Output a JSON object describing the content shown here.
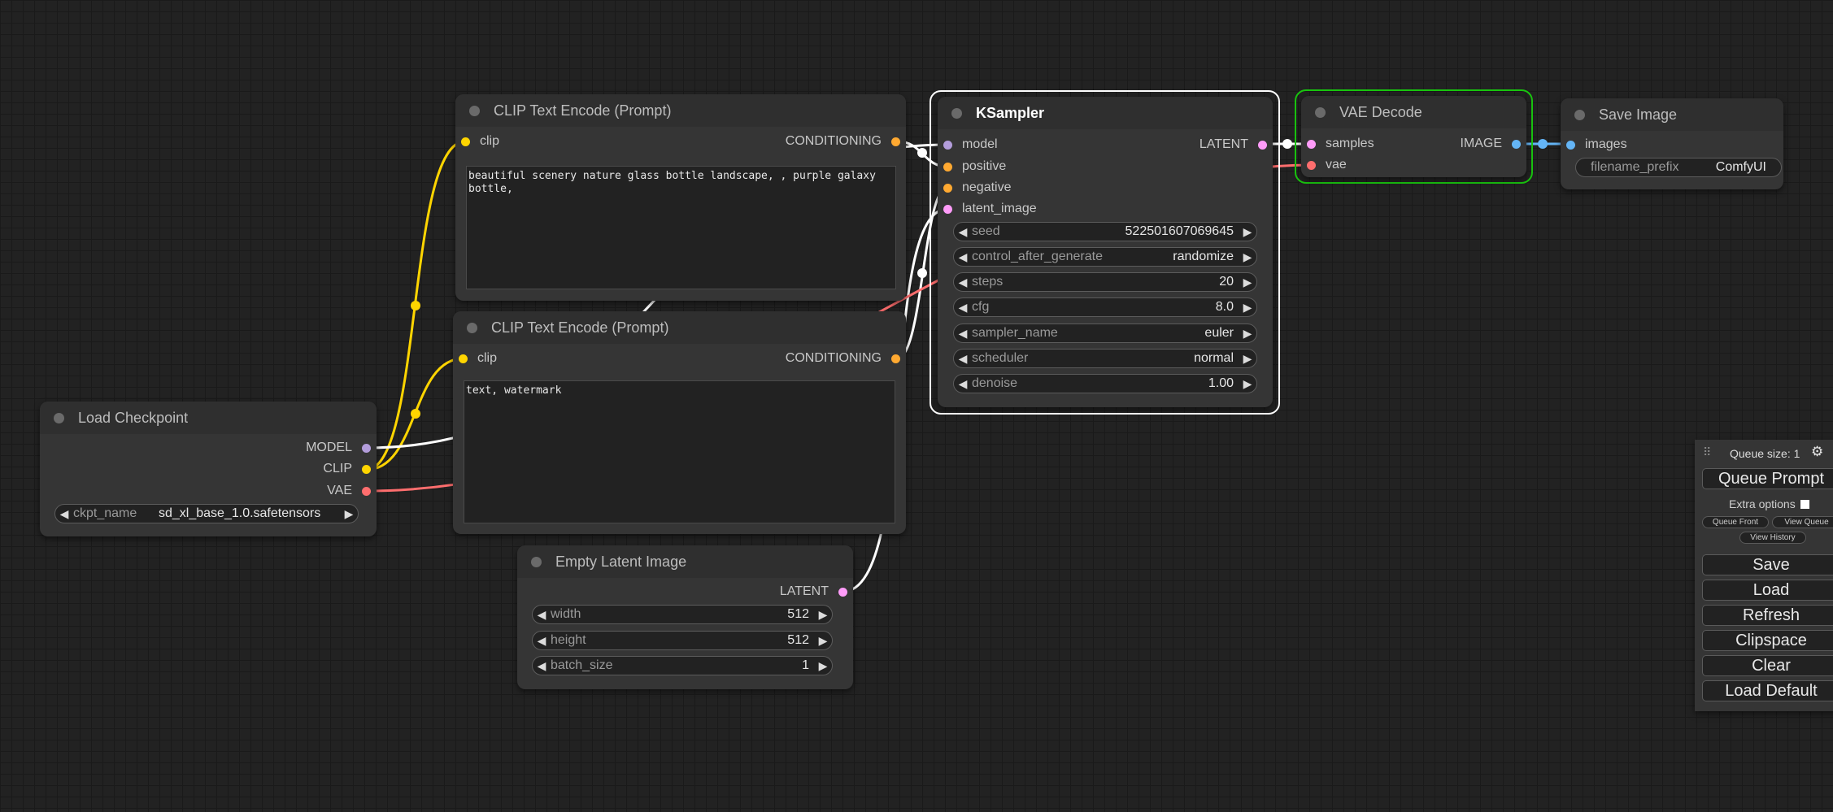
{
  "colors": {
    "model": "#b39ddb",
    "clip": "#ffd500",
    "vae": "#ff6e6e",
    "conditioning": "#ffa931",
    "latent": "#ff9cf9",
    "image": "#64b5f6",
    "link_white": "#ffffff",
    "selected": "#ffffff",
    "executing": "#19c50f"
  },
  "nodes": {
    "clip_pos": {
      "title": "CLIP Text Encode (Prompt)",
      "input_clip": "clip",
      "output": "CONDITIONING",
      "text": "beautiful scenery nature glass bottle landscape, , purple galaxy bottle,"
    },
    "clip_neg": {
      "title": "CLIP Text Encode (Prompt)",
      "input_clip": "clip",
      "output": "CONDITIONING",
      "text": "text, watermark"
    },
    "checkpoint": {
      "title": "Load Checkpoint",
      "outputs": [
        "MODEL",
        "CLIP",
        "VAE"
      ],
      "ckpt_label": "ckpt_name",
      "ckpt_value": "sd_xl_base_1.0.safetensors"
    },
    "latent": {
      "title": "Empty Latent Image",
      "output": "LATENT",
      "widgets": [
        {
          "label": "width",
          "value": "512"
        },
        {
          "label": "height",
          "value": "512"
        },
        {
          "label": "batch_size",
          "value": "1"
        }
      ]
    },
    "ksampler": {
      "title": "KSampler",
      "inputs": [
        "model",
        "positive",
        "negative",
        "latent_image"
      ],
      "output": "LATENT",
      "widgets": [
        {
          "label": "seed",
          "value": "522501607069645"
        },
        {
          "label": "control_after_generate",
          "value": "randomize"
        },
        {
          "label": "steps",
          "value": "20"
        },
        {
          "label": "cfg",
          "value": "8.0"
        },
        {
          "label": "sampler_name",
          "value": "euler"
        },
        {
          "label": "scheduler",
          "value": "normal"
        },
        {
          "label": "denoise",
          "value": "1.00"
        }
      ]
    },
    "vae_decode": {
      "title": "VAE Decode",
      "inputs": [
        "samples",
        "vae"
      ],
      "output": "IMAGE"
    },
    "save_image": {
      "title": "Save Image",
      "input": "images",
      "prefix_label": "filename_prefix",
      "prefix_value": "ComfyUI"
    }
  },
  "queue_panel": {
    "queue_size": "Queue size: 1",
    "queue_prompt": "Queue Prompt",
    "extra_options": "Extra options",
    "queue_front": "Queue Front",
    "view_queue": "View Queue",
    "view_history": "View History",
    "buttons": [
      "Save",
      "Load",
      "Refresh",
      "Clipspace",
      "Clear",
      "Load Default"
    ]
  }
}
